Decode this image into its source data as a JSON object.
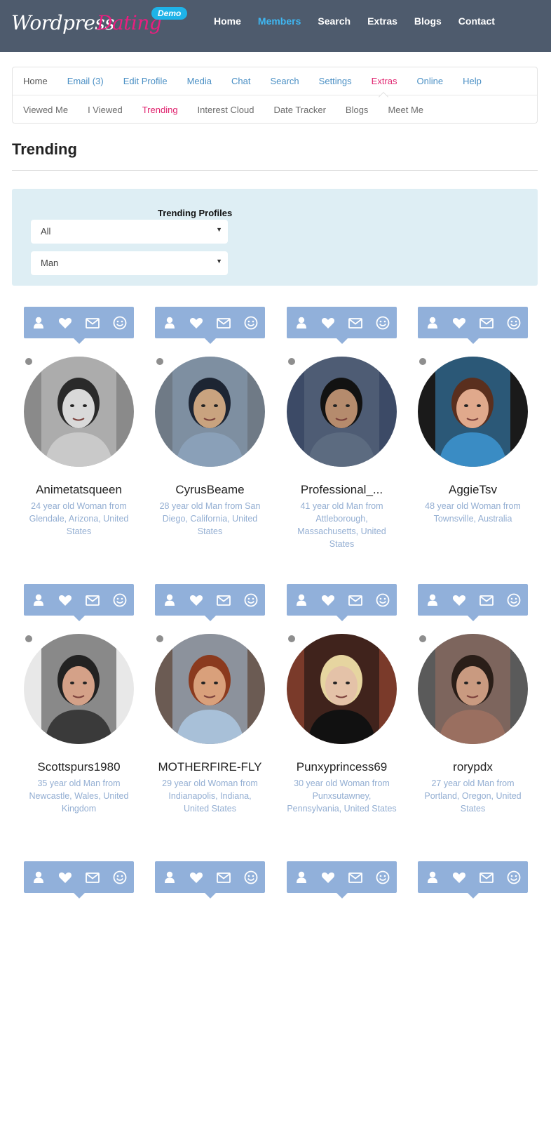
{
  "header": {
    "logo_part1": "Wordpress",
    "logo_part2": "Dating",
    "logo_badge": "Demo",
    "nav": [
      "Home",
      "Members",
      "Search",
      "Extras",
      "Blogs",
      "Contact"
    ],
    "active_nav": "Members"
  },
  "subnav": {
    "row1": [
      "Home",
      "Email (3)",
      "Edit Profile",
      "Media",
      "Chat",
      "Search",
      "Settings",
      "Extras",
      "Online",
      "Help"
    ],
    "row2": [
      "Viewed Me",
      "I Viewed",
      "Trending",
      "Interest Cloud",
      "Date Tracker",
      "Blogs",
      "Meet Me"
    ],
    "active_row1": "Extras",
    "active_row2": "Trending"
  },
  "page": {
    "title": "Trending"
  },
  "filter": {
    "label": "Trending Profiles",
    "select1_value": "All",
    "select2_value": "Man"
  },
  "members": [
    {
      "name": "Animetatsqueen",
      "desc": "24 year old Woman from Glendale, Arizona, United States"
    },
    {
      "name": "CyrusBeame",
      "desc": "28 year old Man from San Diego, California, United States"
    },
    {
      "name": "Professional_...",
      "desc": "41 year old Man from Attleborough, Massachusetts, United States"
    },
    {
      "name": "AggieTsv",
      "desc": "48 year old Woman from Townsville, Australia"
    },
    {
      "name": "Scottspurs1980",
      "desc": "35 year old Man from Newcastle, Wales, United Kingdom"
    },
    {
      "name": "MOTHERFIRE-FLY",
      "desc": "29 year old Woman from Indianapolis, Indiana, United States"
    },
    {
      "name": "Punxyprincess69",
      "desc": "30 year old Woman from Punxsutawney, Pennsylvania, United States"
    },
    {
      "name": "rorypdx",
      "desc": "27 year old Man from Portland, Oregon, United States"
    }
  ],
  "colors": {
    "header_bg": "#4e5b6d",
    "accent_blue": "#3fb7f2",
    "accent_pink": "#e0246f",
    "action_bar": "#91b0da",
    "filter_bg": "#deeef4"
  },
  "icons": [
    "profile-icon",
    "heart-icon",
    "mail-icon",
    "wink-icon"
  ]
}
